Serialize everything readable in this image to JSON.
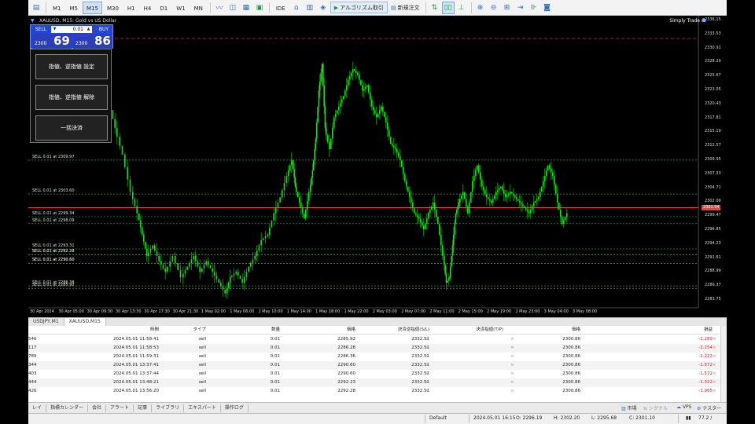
{
  "toolbar": {
    "timeframes": [
      "M1",
      "M5",
      "M15",
      "M30",
      "H1",
      "H4",
      "D1",
      "W1",
      "MN"
    ],
    "active_timeframe": "M15",
    "ide_label": "IDE",
    "algo_label": "アルゴリズム取引",
    "new_order_label": "新規注文"
  },
  "chart": {
    "title": "XAUUSD, M15:  Gold vs US Dollar",
    "brand": "Simply Trade",
    "current_price_label": "2301.04",
    "price_ticks": [
      "2336.15",
      "2333.53",
      "2330.91",
      "2328.29",
      "2325.67",
      "2323.05",
      "2320.43",
      "2317.81",
      "2315.19",
      "2312.57",
      "2309.95",
      "2307.33",
      "2304.71",
      "2302.09",
      "2299.47",
      "2296.85",
      "2294.23",
      "2291.61",
      "2288.99",
      "2286.37",
      "2283.75"
    ],
    "time_ticks": [
      "30 Apr 2024",
      "30 Apr 05:00",
      "30 Apr 09:30",
      "30 Apr 13:30",
      "30 Apr 17:30",
      "30 Apr 21:30",
      "1 May 02:00",
      "1 May 06:00",
      "1 May 10:00",
      "1 May 14:00",
      "1 May 18:00",
      "1 May 22:00",
      "2 May 03:00",
      "2 May 07:00",
      "2 May 11:00",
      "2 May 15:00",
      "2 May 19:00",
      "2 May 23:00",
      "3 May 04:00",
      "3 May 08:00"
    ],
    "order_labels": [
      "SELL 0.01 at 2309.97",
      "SELL 0.01 at 2303.60",
      "SELL 0.01 at 2299.34",
      "SELL 0.01 at 2298.09",
      "SELL 0.01 at 2293.31",
      "SELL 0.01 at 2292.28",
      "SELL 0.01 at 2292.23",
      "SELL 0.01 at 2290.60",
      "SELL 0.01 at 2290.60",
      "SELL 0.01 at 2286.38",
      "SELL 0.01 at 2285.92"
    ]
  },
  "oneclick": {
    "sell_label": "SELL",
    "buy_label": "BUY",
    "lot": "0.01",
    "sell_small": "2300",
    "sell_big": "69",
    "buy_small": "2300",
    "buy_big": "86"
  },
  "side_panel": {
    "btn1": "指値、逆指値 設定",
    "btn2": "指値、逆指値 解除",
    "btn3": "一括決済"
  },
  "chart_tabs": [
    "USDJPY,M1",
    "XAUUSD,M15"
  ],
  "table": {
    "headers": {
      "time": "時間",
      "type": "タイプ",
      "volume": "数量",
      "price": "価格",
      "sl": "決済逆指値(S/L)",
      "tp": "決済指値(T/P)",
      "current": "価格",
      "profit": "損益"
    },
    "rows": [
      {
        "id": "546",
        "time": "2024.05.01 11:58:41",
        "type": "sell",
        "volume": "0.01",
        "price": "2285.92",
        "sl": "2332.51",
        "current": "2300.86",
        "profit": "-2.289"
      },
      {
        "id": "117",
        "time": "2024.05.01 11:58:53",
        "type": "sell",
        "volume": "0.01",
        "price": "2286.28",
        "sl": "2332.51",
        "current": "2300.86",
        "profit": "-2.254"
      },
      {
        "id": "789",
        "time": "2024.05.01 11:59:31",
        "type": "sell",
        "volume": "0.01",
        "price": "2286.36",
        "sl": "2332.51",
        "current": "2300.86",
        "profit": "-2.222"
      },
      {
        "id": "344",
        "time": "2024.05.01 13:37:41",
        "type": "sell",
        "volume": "0.01",
        "price": "2290.60",
        "sl": "2332.51",
        "current": "2300.86",
        "profit": "-1.572"
      },
      {
        "id": "403",
        "time": "2024.05.01 13:37:44",
        "type": "sell",
        "volume": "0.01",
        "price": "2290.60",
        "sl": "2332.51",
        "current": "2300.86",
        "profit": "-1.572"
      },
      {
        "id": "444",
        "time": "2024.05.01 13:48:21",
        "type": "sell",
        "volume": "0.01",
        "price": "2292.23",
        "sl": "2332.51",
        "current": "2300.86",
        "profit": "-1.322"
      },
      {
        "id": "426",
        "time": "2024.05.01 13:56:20",
        "type": "sell",
        "volume": "0.01",
        "price": "2292.28",
        "sl": "2332.51",
        "current": "2300.86",
        "profit": "-1.065"
      }
    ]
  },
  "bottom_tabs": [
    "レイ",
    "指標カレンダー",
    "会社",
    "アラート",
    "記事",
    "ライブラリ",
    "エキスパート",
    "操作ログ"
  ],
  "bottom_right": {
    "market": "市場",
    "signal": "シグナル",
    "vps": "VPS",
    "tester": "テスター"
  },
  "status": {
    "profile": "Default",
    "datetime": "2024.05.01 16:15",
    "open": "O: 2296.19",
    "high": "H: 2302.20",
    "low": "L: 2295.68",
    "close": "C: 2301.10",
    "ping": "77.2 /"
  }
}
